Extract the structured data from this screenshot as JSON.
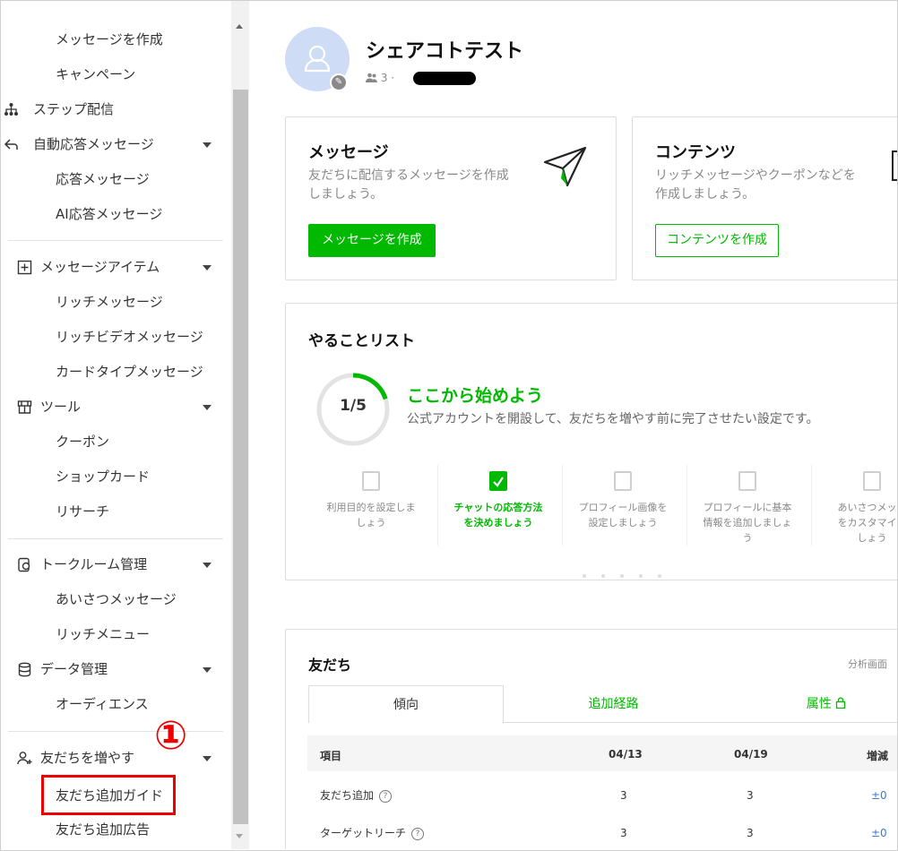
{
  "sidebar": {
    "items": [
      {
        "label": "メッセージを作成",
        "kind": "sub"
      },
      {
        "label": "キャンペーン",
        "kind": "sub"
      },
      {
        "label": "ステップ配信",
        "kind": "head",
        "icon": "step-icon"
      },
      {
        "label": "自動応答メッセージ",
        "kind": "head",
        "icon": "auto-reply-icon",
        "caret": true
      },
      {
        "label": "応答メッセージ",
        "kind": "sub"
      },
      {
        "label": "AI応答メッセージ",
        "kind": "sub"
      },
      {
        "label": "メッセージアイテム",
        "kind": "head",
        "icon": "message-item-icon",
        "caret": true
      },
      {
        "label": "リッチメッセージ",
        "kind": "sub"
      },
      {
        "label": "リッチビデオメッセージ",
        "kind": "sub"
      },
      {
        "label": "カードタイプメッセージ",
        "kind": "sub"
      },
      {
        "label": "ツール",
        "kind": "head",
        "icon": "tool-icon",
        "caret": true
      },
      {
        "label": "クーポン",
        "kind": "sub"
      },
      {
        "label": "ショップカード",
        "kind": "sub"
      },
      {
        "label": "リサーチ",
        "kind": "sub"
      },
      {
        "label": "トークルーム管理",
        "kind": "head",
        "icon": "talkroom-icon",
        "caret": true
      },
      {
        "label": "あいさつメッセージ",
        "kind": "sub"
      },
      {
        "label": "リッチメニュー",
        "kind": "sub"
      },
      {
        "label": "データ管理",
        "kind": "head",
        "icon": "database-icon",
        "caret": true
      },
      {
        "label": "オーディエンス",
        "kind": "sub"
      },
      {
        "label": "友だちを増やす",
        "kind": "head",
        "icon": "add-friend-icon",
        "caret": true
      },
      {
        "label": "友だち追加ガイド",
        "kind": "sub",
        "highlighted": true
      },
      {
        "label": "友だち追加広告",
        "kind": "sub"
      }
    ]
  },
  "account": {
    "name": "シェアコトテスト",
    "member_count": "3",
    "meta_sep": "·"
  },
  "cards": {
    "message": {
      "title": "メッセージ",
      "desc_line1": "友だちに配信するメッセージを作成",
      "desc_line2": "しましょう。",
      "button": "メッセージを作成"
    },
    "content": {
      "title": "コンテンツ",
      "desc_line1": "リッチメッセージやクーポンなどを",
      "desc_line2": "作成しましょう。",
      "button": "コンテンツを作成"
    }
  },
  "todo": {
    "title": "やることリスト",
    "progress_label": "1/5",
    "progress_fraction": 0.2,
    "headline": "ここから始めよう",
    "subtext": "公式アカウントを開設して、友だちを増やす前に完了させたい設定です。",
    "steps": [
      {
        "lines": [
          "利用目的を設定しま",
          "しょう"
        ],
        "active": false
      },
      {
        "lines": [
          "チャットの応答方法",
          "を決めましょう"
        ],
        "active": true
      },
      {
        "lines": [
          "プロフィール画像を",
          "設定しましょう"
        ],
        "active": false
      },
      {
        "lines": [
          "プロフィールに基本",
          "情報を追加しましょ",
          "う"
        ],
        "active": false
      },
      {
        "lines": [
          "あいさつメッセ",
          "をカスタマイズ",
          "しょう"
        ],
        "active": false
      }
    ],
    "pager_dots": 5
  },
  "friends": {
    "title": "友だち",
    "analysis_link": "分析画面",
    "tabs": [
      "傾向",
      "追加経路",
      "属性"
    ],
    "columns": [
      "項目",
      "04/13",
      "04/19",
      "増減"
    ],
    "rows": [
      {
        "label": "友だち追加",
        "c1": "3",
        "c2": "3",
        "delta": "±0"
      },
      {
        "label": "ターゲットリーチ",
        "c1": "3",
        "c2": "3",
        "delta": "±0"
      }
    ]
  },
  "annotation": {
    "number": "①"
  },
  "colors": {
    "brand_green": "#00b900",
    "annotation_red": "#e00000",
    "delta_blue": "#3a7bd5"
  }
}
